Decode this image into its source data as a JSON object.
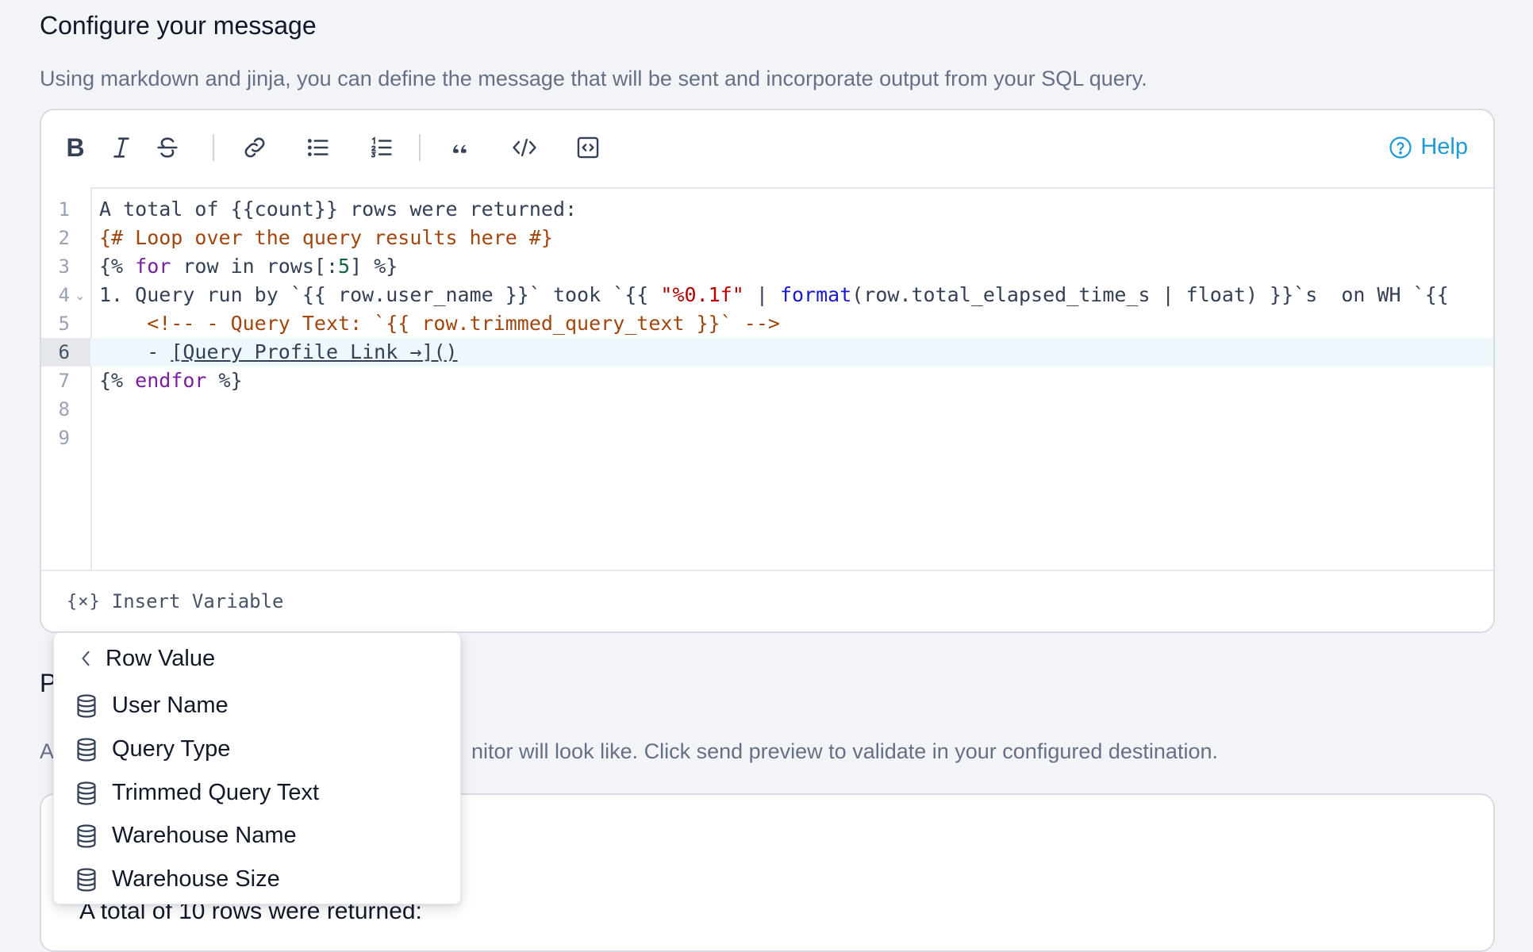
{
  "header": {
    "title": "Configure your message",
    "description": "Using markdown and jinja, you can define the message that will be sent and incorporate output from your SQL query."
  },
  "toolbar": {
    "bold": "B",
    "help_label": "Help"
  },
  "editor": {
    "lines": [
      {
        "n": "1"
      },
      {
        "n": "2"
      },
      {
        "n": "3"
      },
      {
        "n": "4"
      },
      {
        "n": "5"
      },
      {
        "n": "6"
      },
      {
        "n": "7"
      },
      {
        "n": "8"
      },
      {
        "n": "9"
      }
    ],
    "code": {
      "l1": "A total of {{count}} rows were returned:",
      "l2": "{# Loop over the query results here #}",
      "l3_a": "{% ",
      "l3_kw": "for",
      "l3_b": " row in rows[:",
      "l3_num": "5",
      "l3_c": "] %}",
      "l4_a": "1. Query run by `{{ row.user_name }}` took `{{ ",
      "l4_str": "\"%0.1f\"",
      "l4_b": " | ",
      "l4_fn": "format",
      "l4_c": "(row.total_elapsed_time_s | float) }}`s  on WH `{{",
      "l5": "    <!-- - Query Text: `{{ row.trimmed_query_text }}` -->",
      "l6_a": "    - ",
      "l6_link": "[Query Profile Link →]()",
      "l7_a": "{% ",
      "l7_kw": "endfor",
      "l7_b": " %}"
    },
    "insert_variable_icon": "{×}",
    "insert_variable_label": "Insert Variable"
  },
  "dropdown": {
    "title": "Row Value",
    "items": [
      {
        "label": "User Name"
      },
      {
        "label": "Query Type"
      },
      {
        "label": "Trimmed Query Text"
      },
      {
        "label": "Warehouse Name"
      },
      {
        "label": "Warehouse Size"
      }
    ]
  },
  "preview": {
    "title_partial": "P",
    "description_partial_left": "A",
    "description_partial_right": "nitor will look like. Click send preview to validate in your configured destination.",
    "text": "A total of 10 rows were returned:"
  },
  "colors": {
    "accent": "#1d9bd7",
    "comment": "#a0460e",
    "keyword": "#7a1fa2",
    "string": "#b30000",
    "function": "#1a1acb"
  }
}
